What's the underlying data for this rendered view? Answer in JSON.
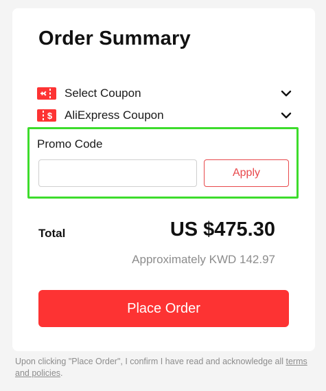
{
  "summary": {
    "title": "Order Summary"
  },
  "coupons": [
    {
      "label": "Select Coupon",
      "icon": "coupon-ticket-icon",
      "icon_color": "#fd3333"
    },
    {
      "label": "AliExpress Coupon",
      "icon": "dollar-coupon-icon",
      "icon_color": "#fd3333"
    }
  ],
  "promo": {
    "label": "Promo Code",
    "value": "",
    "placeholder": "",
    "apply_label": "Apply"
  },
  "total": {
    "label": "Total",
    "value": "US $475.30",
    "approx": "Approximately KWD 142.97"
  },
  "actions": {
    "place_order_label": "Place Order"
  },
  "footer": {
    "disclaimer": "Upon clicking \"Place Order\", I confirm I have read and acknowledge all",
    "link_text": "terms and policies",
    "suffix": "."
  },
  "colors": {
    "accent": "#fd3333",
    "apply_border": "#e8484b",
    "highlight": "#3ddc2c",
    "muted": "#8c8c8c"
  }
}
